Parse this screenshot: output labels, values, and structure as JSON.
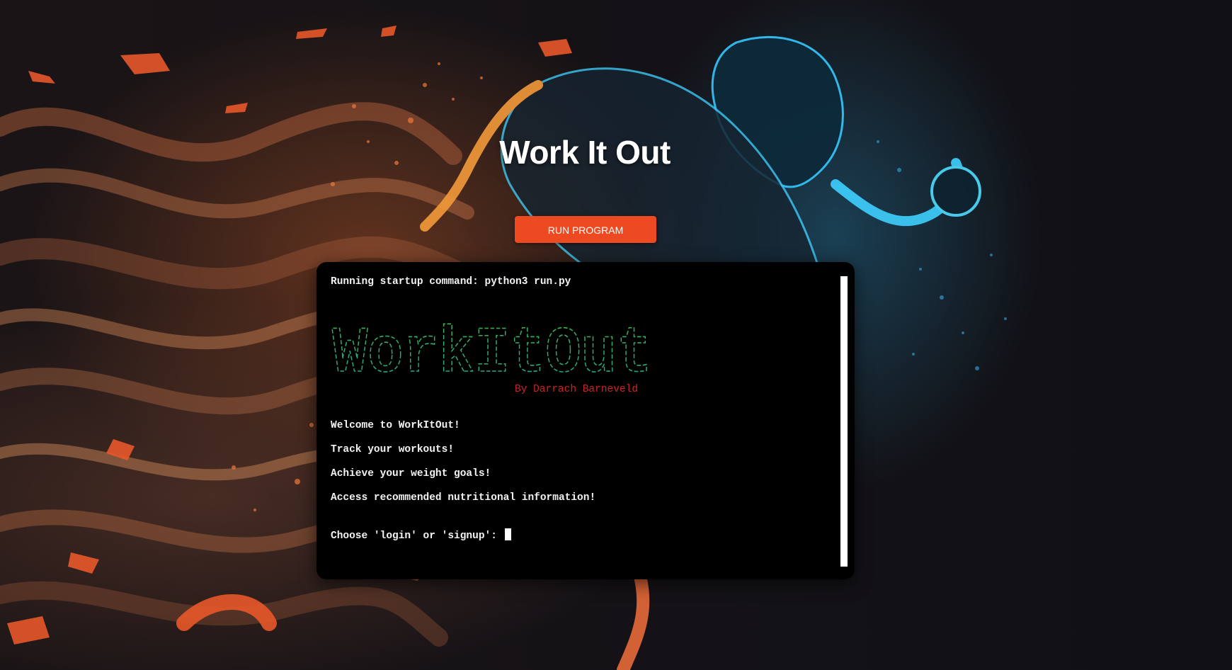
{
  "page": {
    "title": "Work It Out",
    "run_button_label": "RUN PROGRAM"
  },
  "terminal": {
    "startup_line": "Running startup command: python3 run.py",
    "logo_art_text": "WorkItOut",
    "byline": "By Darrach Barneveld",
    "welcome_lines": [
      "Welcome to WorkItOut!",
      "Track your workouts!",
      "Achieve your weight goals!",
      "Access recommended nutritional information!"
    ],
    "prompt": "Choose 'login' or 'signup': "
  },
  "colors": {
    "accent": "#ee4a22",
    "byline": "#d61f1f",
    "ascii_top": "#3fb548",
    "ascii_bottom": "#1aa3a3",
    "terminal_bg": "#000000"
  },
  "icons": {
    "background_art": "runner-illustration",
    "cursor": "block-cursor"
  }
}
